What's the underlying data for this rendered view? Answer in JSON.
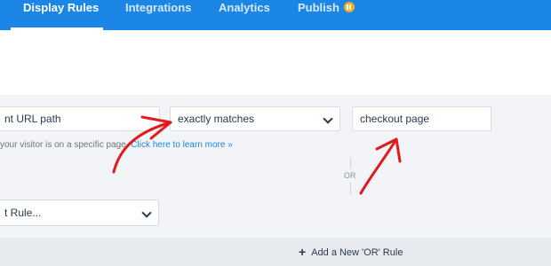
{
  "tabs": [
    {
      "label": "Display Rules",
      "active": true
    },
    {
      "label": "Integrations",
      "active": false
    },
    {
      "label": "Analytics",
      "active": false
    },
    {
      "label": "Publish",
      "active": false,
      "badge": "pause-icon"
    }
  ],
  "rule": {
    "condition_value": "nt URL path",
    "operator_value": "exactly matches",
    "match_value": "checkout page",
    "helper_text": "your visitor is on a specific page.",
    "helper_link": "Click here to learn more »",
    "or_label": "OR",
    "second_rule_value": "t Rule..."
  },
  "footer": {
    "add_or_rule_label": "Add a New 'OR' Rule"
  },
  "colors": {
    "nav_bg": "#1c86e6",
    "badge": "#f3b21a",
    "annotation_arrow": "#e01b1b",
    "link": "#1c86e6"
  }
}
